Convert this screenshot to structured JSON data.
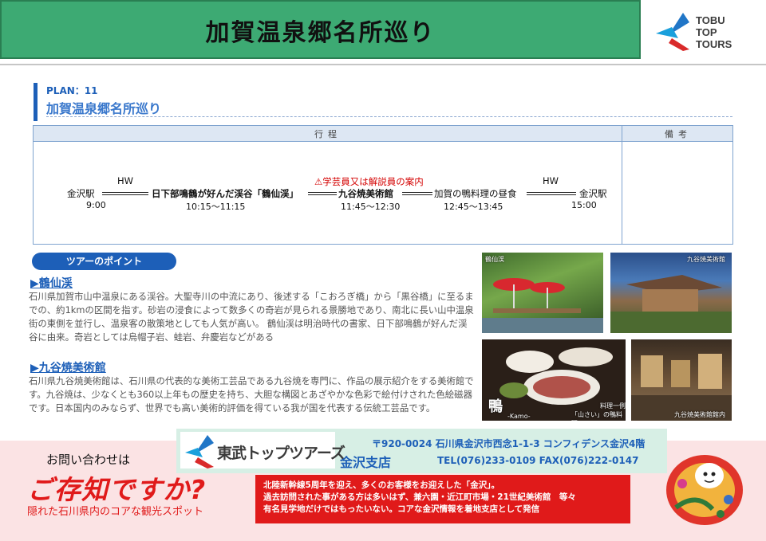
{
  "header": {
    "title": "加賀温泉郷名所巡り"
  },
  "logo": {
    "line1": "TOBU",
    "line2": "TOP",
    "line3": "TOURS"
  },
  "plan": {
    "label": "PLAN：11",
    "title": "加賀温泉郷名所巡り"
  },
  "itinerary": {
    "col_route": "行程",
    "col_notes": "備考",
    "hw1": "HW",
    "hw2": "HW",
    "guide_note": "⚠学芸員又は解説員の案内",
    "stops": [
      {
        "name": "金沢駅",
        "time": "9:00"
      },
      {
        "name": "日下部鳴鶴が好んだ渓谷「鶴仙渓」",
        "time": "10:15～11:15"
      },
      {
        "name": "九谷焼美術館",
        "time": "11:45～12:30"
      },
      {
        "name": "加賀の鴨料理の昼食",
        "time": "12:45～13:45"
      },
      {
        "name": "金沢駅",
        "time": "15:00"
      }
    ]
  },
  "points": {
    "pill": "ツアーのポイント",
    "sections": [
      {
        "heading": "▶鶴仙渓",
        "body": "石川県加賀市山中温泉にある渓谷。大聖寺川の中流にあり、後述する「こおろぎ橋」から「黒谷橋」に至るまでの、約1kmの区間を指す。砂岩の浸食によって数多くの奇岩が見られる景勝地であり、南北に長い山中温泉街の東側を並行し、温泉客の散策地としても人気が高い。 鶴仙渓は明治時代の書家、日下部鳴鶴が好んだ渓谷に由来。奇岩としては烏帽子岩、蛙岩、弁慶岩などがある"
      },
      {
        "heading": "▶九谷焼美術館",
        "body": "石川県九谷焼美術館は、石川県の代表的な美術工芸品である九谷焼を専門に、作品の展示紹介をする美術館です。九谷焼は、少なくとも360以上年もの歴史を持ち、大胆な構図とあざやかな色彩で絵付けされた色絵磁器です。日本国内のみならず、世界でも高い美術的評価を得ている我が国を代表する伝統工芸品です。"
      }
    ]
  },
  "photos": {
    "p1": "鶴仙渓",
    "p2": "九谷焼美術館",
    "p3_brush": "鴨",
    "p3_sub": "-Kamo-",
    "p3_cap1": "料理一例",
    "p3_cap2": "「山さい」の鴨料理",
    "p4": "九谷焼美術館館内"
  },
  "footer": {
    "contact_label": "お問い合わせは",
    "headline": "ご存知ですか?",
    "tagline": "隠れた石川県内のコアな観光スポット",
    "company_logo": "東武トップツアーズ",
    "branch": "金沢支店",
    "address": "〒920-0024  石川県金沢市西念1-1-3 コンフィデンス金沢4階",
    "tel": "TEL(076)233-0109  FAX(076)222-0147",
    "promo": [
      "北陸新幹線5周年を迎え、多くのお客様をお迎えした「金沢」。",
      "過去訪問された事がある方は多いはず、兼六園・近江町市場・21世紀美術館　等々",
      "有名見学地だけではもったいない。コアな金沢情報を着地支店として発信"
    ]
  },
  "colors": {
    "header_green": "#3daa73",
    "accent_blue": "#1d5fb8",
    "alert_red": "#e01a1a",
    "footer_pink": "#fbe3e4"
  }
}
